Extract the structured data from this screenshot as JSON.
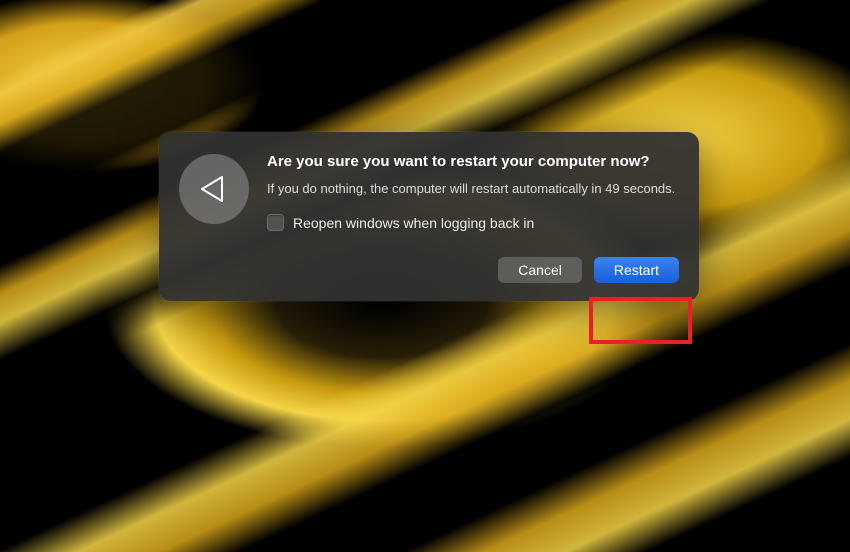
{
  "dialog": {
    "title": "Are you sure you want to restart your computer now?",
    "message": "If you do nothing, the computer will restart automatically in 49 seconds.",
    "checkbox_label": "Reopen windows when logging back in",
    "cancel_label": "Cancel",
    "restart_label": "Restart"
  }
}
